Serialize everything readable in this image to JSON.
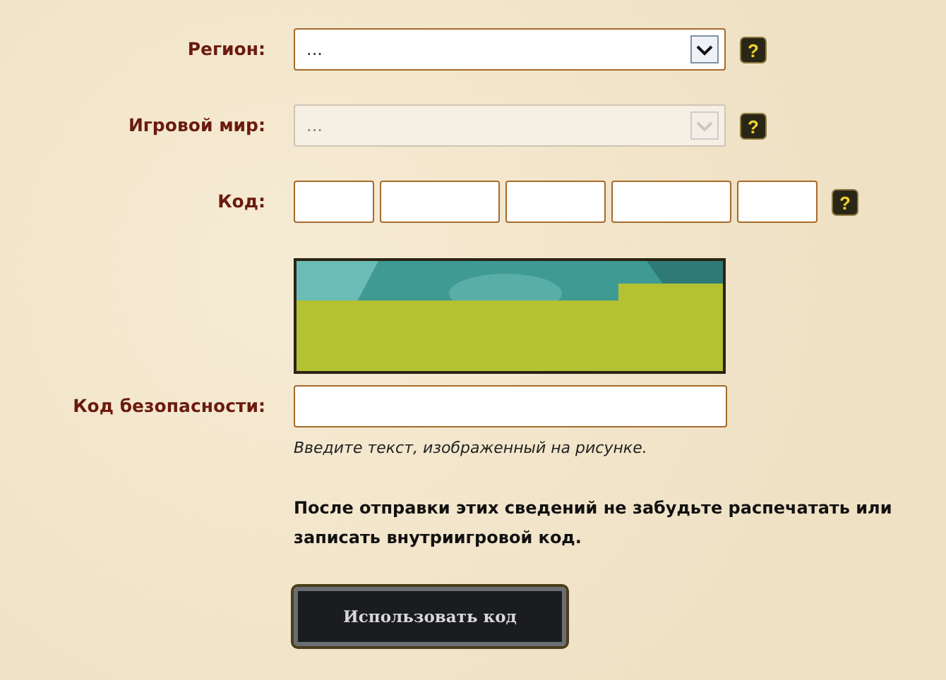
{
  "region": {
    "label": "Регион:",
    "value": "...",
    "disabled": false,
    "help": "?"
  },
  "realm": {
    "label": "Игровой мир:",
    "value": "...",
    "disabled": true,
    "help": "?"
  },
  "code": {
    "label": "Код:",
    "help": "?",
    "segments": [
      {
        "kind": "short"
      },
      {
        "kind": "long"
      },
      {
        "kind": "medium"
      },
      {
        "kind": "long"
      },
      {
        "kind": "short"
      }
    ]
  },
  "security": {
    "label": "Код безопасности:",
    "hint": "Введите текст, изображенный на рисунке."
  },
  "notice": "После отправки этих сведений не забудьте распечатать или записать внутриигровой код.",
  "submit": "Использовать код"
}
